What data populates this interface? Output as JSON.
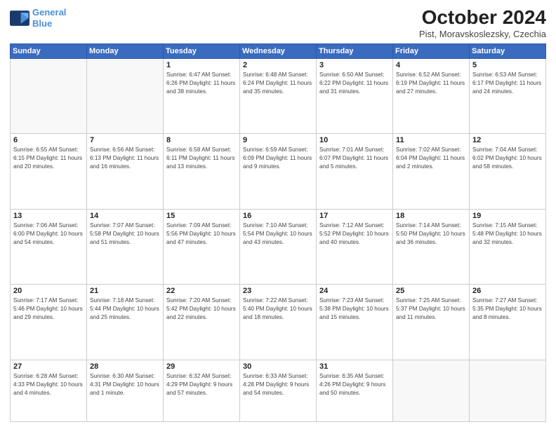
{
  "header": {
    "logo_line1": "General",
    "logo_line2": "Blue",
    "month": "October 2024",
    "location": "Pist, Moravskoslezsky, Czechia"
  },
  "weekdays": [
    "Sunday",
    "Monday",
    "Tuesday",
    "Wednesday",
    "Thursday",
    "Friday",
    "Saturday"
  ],
  "weeks": [
    [
      {
        "day": "",
        "detail": ""
      },
      {
        "day": "",
        "detail": ""
      },
      {
        "day": "1",
        "detail": "Sunrise: 6:47 AM\nSunset: 6:26 PM\nDaylight: 11 hours\nand 38 minutes."
      },
      {
        "day": "2",
        "detail": "Sunrise: 6:48 AM\nSunset: 6:24 PM\nDaylight: 11 hours\nand 35 minutes."
      },
      {
        "day": "3",
        "detail": "Sunrise: 6:50 AM\nSunset: 6:22 PM\nDaylight: 11 hours\nand 31 minutes."
      },
      {
        "day": "4",
        "detail": "Sunrise: 6:52 AM\nSunset: 6:19 PM\nDaylight: 11 hours\nand 27 minutes."
      },
      {
        "day": "5",
        "detail": "Sunrise: 6:53 AM\nSunset: 6:17 PM\nDaylight: 11 hours\nand 24 minutes."
      }
    ],
    [
      {
        "day": "6",
        "detail": "Sunrise: 6:55 AM\nSunset: 6:15 PM\nDaylight: 11 hours\nand 20 minutes."
      },
      {
        "day": "7",
        "detail": "Sunrise: 6:56 AM\nSunset: 6:13 PM\nDaylight: 11 hours\nand 16 minutes."
      },
      {
        "day": "8",
        "detail": "Sunrise: 6:58 AM\nSunset: 6:11 PM\nDaylight: 11 hours\nand 13 minutes."
      },
      {
        "day": "9",
        "detail": "Sunrise: 6:59 AM\nSunset: 6:09 PM\nDaylight: 11 hours\nand 9 minutes."
      },
      {
        "day": "10",
        "detail": "Sunrise: 7:01 AM\nSunset: 6:07 PM\nDaylight: 11 hours\nand 5 minutes."
      },
      {
        "day": "11",
        "detail": "Sunrise: 7:02 AM\nSunset: 6:04 PM\nDaylight: 11 hours\nand 2 minutes."
      },
      {
        "day": "12",
        "detail": "Sunrise: 7:04 AM\nSunset: 6:02 PM\nDaylight: 10 hours\nand 58 minutes."
      }
    ],
    [
      {
        "day": "13",
        "detail": "Sunrise: 7:06 AM\nSunset: 6:00 PM\nDaylight: 10 hours\nand 54 minutes."
      },
      {
        "day": "14",
        "detail": "Sunrise: 7:07 AM\nSunset: 5:58 PM\nDaylight: 10 hours\nand 51 minutes."
      },
      {
        "day": "15",
        "detail": "Sunrise: 7:09 AM\nSunset: 5:56 PM\nDaylight: 10 hours\nand 47 minutes."
      },
      {
        "day": "16",
        "detail": "Sunrise: 7:10 AM\nSunset: 5:54 PM\nDaylight: 10 hours\nand 43 minutes."
      },
      {
        "day": "17",
        "detail": "Sunrise: 7:12 AM\nSunset: 5:52 PM\nDaylight: 10 hours\nand 40 minutes."
      },
      {
        "day": "18",
        "detail": "Sunrise: 7:14 AM\nSunset: 5:50 PM\nDaylight: 10 hours\nand 36 minutes."
      },
      {
        "day": "19",
        "detail": "Sunrise: 7:15 AM\nSunset: 5:48 PM\nDaylight: 10 hours\nand 32 minutes."
      }
    ],
    [
      {
        "day": "20",
        "detail": "Sunrise: 7:17 AM\nSunset: 5:46 PM\nDaylight: 10 hours\nand 29 minutes."
      },
      {
        "day": "21",
        "detail": "Sunrise: 7:18 AM\nSunset: 5:44 PM\nDaylight: 10 hours\nand 25 minutes."
      },
      {
        "day": "22",
        "detail": "Sunrise: 7:20 AM\nSunset: 5:42 PM\nDaylight: 10 hours\nand 22 minutes."
      },
      {
        "day": "23",
        "detail": "Sunrise: 7:22 AM\nSunset: 5:40 PM\nDaylight: 10 hours\nand 18 minutes."
      },
      {
        "day": "24",
        "detail": "Sunrise: 7:23 AM\nSunset: 5:38 PM\nDaylight: 10 hours\nand 15 minutes."
      },
      {
        "day": "25",
        "detail": "Sunrise: 7:25 AM\nSunset: 5:37 PM\nDaylight: 10 hours\nand 11 minutes."
      },
      {
        "day": "26",
        "detail": "Sunrise: 7:27 AM\nSunset: 5:35 PM\nDaylight: 10 hours\nand 8 minutes."
      }
    ],
    [
      {
        "day": "27",
        "detail": "Sunrise: 6:28 AM\nSunset: 4:33 PM\nDaylight: 10 hours\nand 4 minutes."
      },
      {
        "day": "28",
        "detail": "Sunrise: 6:30 AM\nSunset: 4:31 PM\nDaylight: 10 hours\nand 1 minute."
      },
      {
        "day": "29",
        "detail": "Sunrise: 6:32 AM\nSunset: 4:29 PM\nDaylight: 9 hours\nand 57 minutes."
      },
      {
        "day": "30",
        "detail": "Sunrise: 6:33 AM\nSunset: 4:28 PM\nDaylight: 9 hours\nand 54 minutes."
      },
      {
        "day": "31",
        "detail": "Sunrise: 6:35 AM\nSunset: 4:26 PM\nDaylight: 9 hours\nand 50 minutes."
      },
      {
        "day": "",
        "detail": ""
      },
      {
        "day": "",
        "detail": ""
      }
    ]
  ]
}
